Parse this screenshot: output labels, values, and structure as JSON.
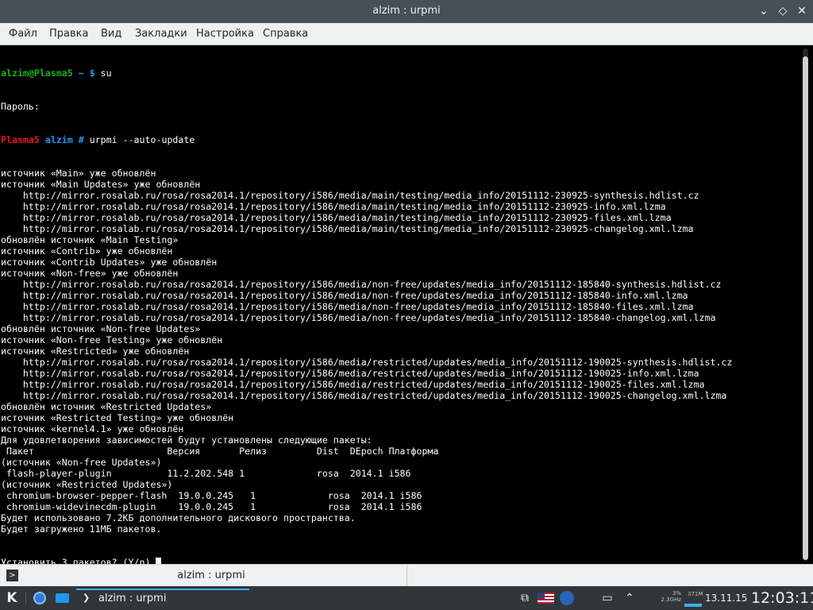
{
  "window": {
    "title": "alzim : urpmi"
  },
  "menu": [
    "Файл",
    "Правка",
    "Вид",
    "Закладки",
    "Настройка",
    "Справка"
  ],
  "terminal": {
    "prompt1": {
      "user": "alzim@Plasma5",
      "dir": "~",
      "sym": "$",
      "cmd": "su"
    },
    "password_line": "Пароль:",
    "prompt2": {
      "host": "Plasma5",
      "dir": "alzim",
      "sym": "#",
      "cmd": "urpmi --auto-update"
    },
    "lines": [
      "источник «Main» уже обновлён",
      "источник «Main Updates» уже обновлён",
      "    http://mirror.rosalab.ru/rosa/rosa2014.1/repository/i586/media/main/testing/media_info/20151112-230925-synthesis.hdlist.cz",
      "    http://mirror.rosalab.ru/rosa/rosa2014.1/repository/i586/media/main/testing/media_info/20151112-230925-info.xml.lzma",
      "    http://mirror.rosalab.ru/rosa/rosa2014.1/repository/i586/media/main/testing/media_info/20151112-230925-files.xml.lzma",
      "    http://mirror.rosalab.ru/rosa/rosa2014.1/repository/i586/media/main/testing/media_info/20151112-230925-changelog.xml.lzma",
      "обновлён источник «Main Testing»",
      "источник «Contrib» уже обновлён",
      "источник «Contrib Updates» уже обновлён",
      "источник «Non-free» уже обновлён",
      "    http://mirror.rosalab.ru/rosa/rosa2014.1/repository/i586/media/non-free/updates/media_info/20151112-185840-synthesis.hdlist.cz",
      "    http://mirror.rosalab.ru/rosa/rosa2014.1/repository/i586/media/non-free/updates/media_info/20151112-185840-info.xml.lzma",
      "    http://mirror.rosalab.ru/rosa/rosa2014.1/repository/i586/media/non-free/updates/media_info/20151112-185840-files.xml.lzma",
      "    http://mirror.rosalab.ru/rosa/rosa2014.1/repository/i586/media/non-free/updates/media_info/20151112-185840-changelog.xml.lzma",
      "обновлён источник «Non-free Updates»",
      "источник «Non-free Testing» уже обновлён",
      "источник «Restricted» уже обновлён",
      "    http://mirror.rosalab.ru/rosa/rosa2014.1/repository/i586/media/restricted/updates/media_info/20151112-190025-synthesis.hdlist.cz",
      "    http://mirror.rosalab.ru/rosa/rosa2014.1/repository/i586/media/restricted/updates/media_info/20151112-190025-info.xml.lzma",
      "    http://mirror.rosalab.ru/rosa/rosa2014.1/repository/i586/media/restricted/updates/media_info/20151112-190025-files.xml.lzma",
      "    http://mirror.rosalab.ru/rosa/rosa2014.1/repository/i586/media/restricted/updates/media_info/20151112-190025-changelog.xml.lzma",
      "обновлён источник «Restricted Updates»",
      "источник «Restricted Testing» уже обновлён",
      "источник «kernel4.1» уже обновлён",
      "Для удовлетворения зависимостей будут установлены следующие пакеты:",
      " Пакет                        Версия       Релиз         Dist  DEpoch Платформа",
      "(источник «Non-free Updates»)",
      " flash-player-plugin          11.2.202.548 1             rosa  2014.1 i586",
      "(источник «Restricted Updates»)",
      " chromium-browser-pepper-flash  19.0.0.245   1             rosa  2014.1 i586",
      " chromium-widevinecdm-plugin    19.0.0.245   1             rosa  2014.1 i586",
      "Будет использовано 7.2КБ дополнительного дискового пространства.",
      "Будет загружено 11МБ пакетов."
    ],
    "final_prompt": "Установить 3 пакетов? (Y/n) "
  },
  "tab": {
    "label": "alzim : urpmi"
  },
  "panel": {
    "task_label": "alzim : urpmi",
    "date": "13.11.15",
    "clock": "12:03:11",
    "monitor": {
      "cpu": "3%",
      "freq": "2.3GHz",
      "mem": "371M"
    }
  },
  "colors": {
    "titlebar": "#475057",
    "panel": "#31363b",
    "prompt_green": "#18b218",
    "prompt_blue": "#1d99f3",
    "prompt_red": "#ed1515",
    "accent": "#3daee9"
  }
}
